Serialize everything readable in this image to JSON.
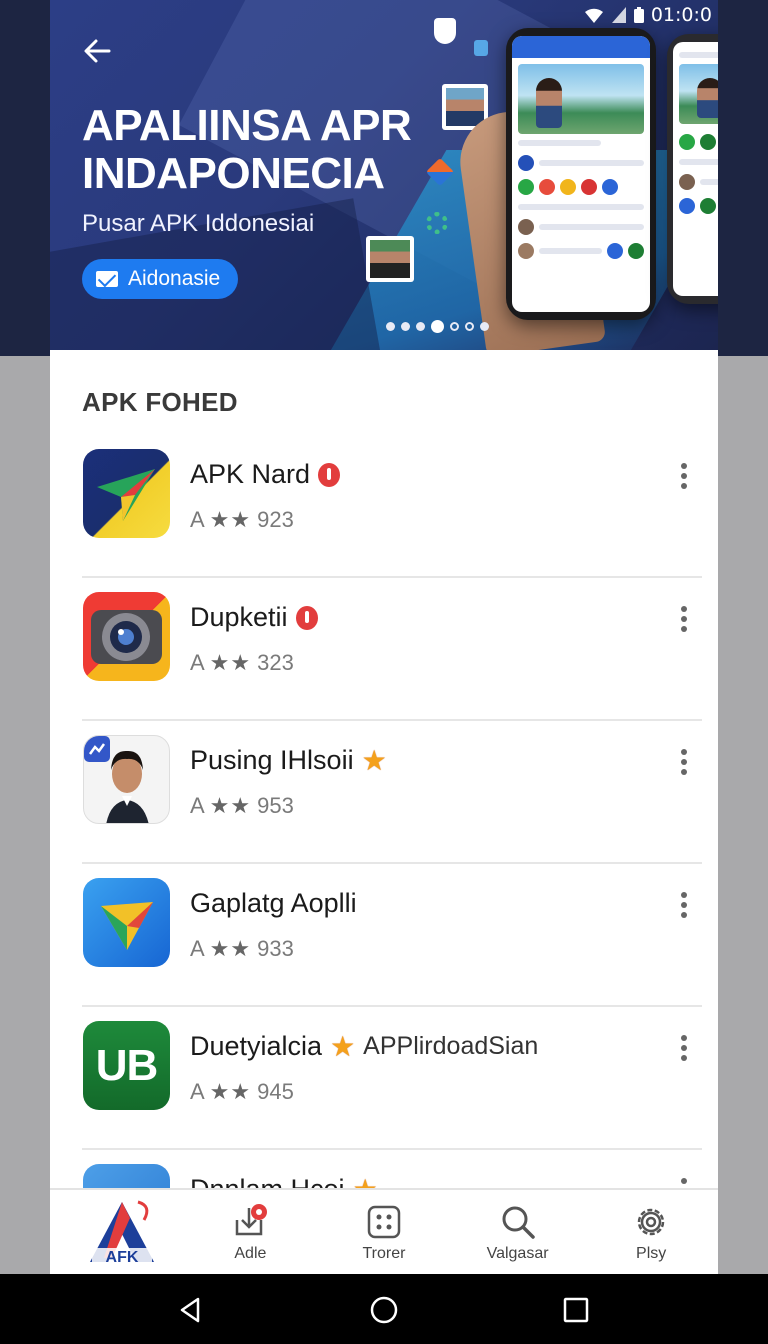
{
  "status_bar": {
    "time": "01:0:0",
    "wifi_icon": "wifi-icon",
    "signal_icon": "signal-icon",
    "battery_icon": "battery-icon"
  },
  "hero": {
    "title": "APALIINSA APR INDAPONECIA",
    "subtitle": "Pusar  APK Iddonesiai",
    "cta_label": "Aidonasie",
    "slides": {
      "count": 7,
      "active_index": 3
    }
  },
  "section": {
    "title": "APK FOHED"
  },
  "apps": [
    {
      "name": "APK Nard",
      "rating_prefix": "A",
      "stars": "★★",
      "count": "923",
      "badge": "red"
    },
    {
      "name": "Dupketii",
      "rating_prefix": "A",
      "stars": "★★",
      "count": "323",
      "badge": "red"
    },
    {
      "name": "Pusing IHlsoii",
      "rating_prefix": "A",
      "stars": "★★",
      "count": "953",
      "badge": "star"
    },
    {
      "name": "Gaplatg Aoplli",
      "rating_prefix": "A",
      "stars": "★★",
      "count": "933",
      "badge": "none"
    },
    {
      "name": "Duetyialcia",
      "extra": "APPlirdoadSian",
      "rating_prefix": "A",
      "stars": "★★",
      "count": "945",
      "badge": "star",
      "icon_text": "UB"
    },
    {
      "name": "Dnnlam Hcoi",
      "badge": "star"
    }
  ],
  "bottom_nav": {
    "logo_text": "AFK",
    "items": [
      {
        "label": ""
      },
      {
        "label": "Adle"
      },
      {
        "label": "Trorer"
      },
      {
        "label": "Valgasar"
      },
      {
        "label": "Plsy"
      }
    ]
  },
  "colors": {
    "accent": "#1e7bf0",
    "hero_bg": "#2a3a7c",
    "badge_red": "#e23d3d",
    "star": "#f4a11c",
    "icon_green": "#1e8a3b"
  }
}
